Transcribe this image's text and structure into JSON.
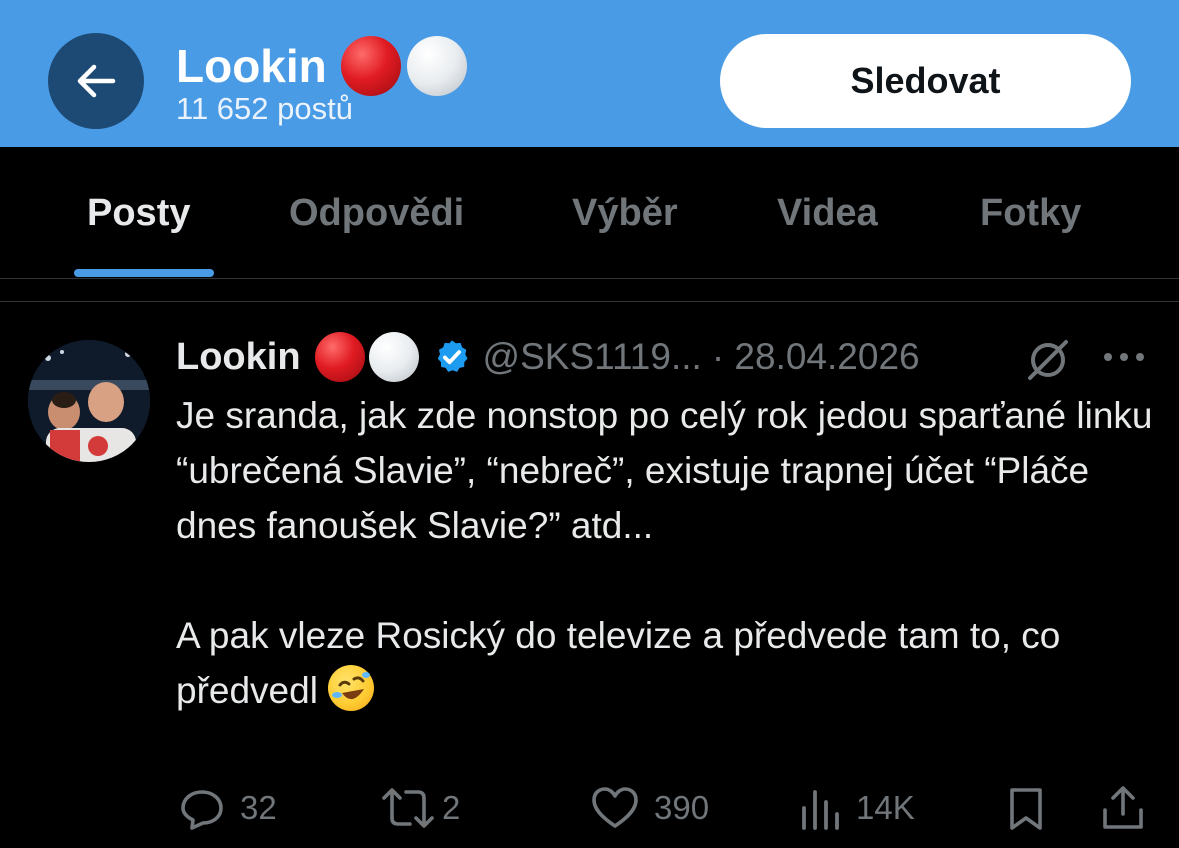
{
  "header": {
    "title": "Lookin",
    "post_count": "11 652 postů",
    "follow_label": "Sledovat",
    "icons": [
      "back-arrow-icon",
      "red-circle-emoji",
      "white-circle-emoji"
    ]
  },
  "tabs": [
    {
      "label": "Posty",
      "active": true
    },
    {
      "label": "Odpovědi",
      "active": false
    },
    {
      "label": "Výběr",
      "active": false
    },
    {
      "label": "Videa",
      "active": false
    },
    {
      "label": "Fotky",
      "active": false
    }
  ],
  "post": {
    "author": "Lookin",
    "handle": "@SKS1119...",
    "date": "· 28.04.2026",
    "text_p1": "Je sranda, jak zde nonstop po celý rok jedou sparťané linku “ubrečená Slavie”, “nebreč”, existuje trapnej účet “Pláče dnes fanoušek Slavie?” atd...",
    "text_p2": "A pak vleze Rosický do televize a předvede tam to, co předvedl",
    "emoji": "rolling-on-floor-laughing-emoji",
    "stats": {
      "replies": "32",
      "reposts": "2",
      "likes": "390",
      "views": "14K"
    }
  },
  "colors": {
    "header_bg": "#4a9be6",
    "back_button_bg": "#1d4a75",
    "background": "#000000",
    "text_primary": "#e7e9ea",
    "text_secondary": "#71767b",
    "verified": "#1d9bf0"
  }
}
